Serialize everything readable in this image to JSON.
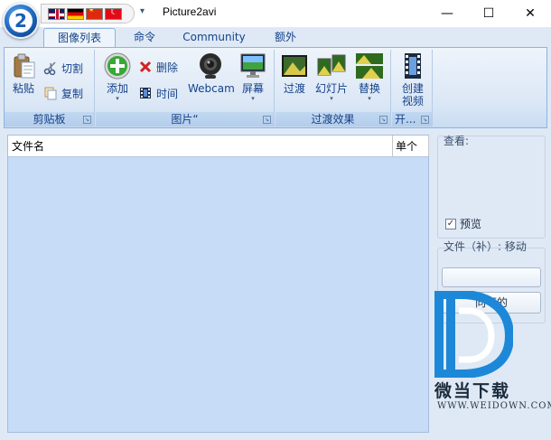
{
  "window": {
    "title": "Picture2avi",
    "app_orb_glyph": "2",
    "controls": {
      "minimize": "—",
      "maximize": "☐",
      "close": "✕"
    },
    "qat_dropdown": "▾"
  },
  "language_flags": [
    "uk-flag-icon",
    "de-flag-icon",
    "cn-flag-icon",
    "tr-flag-icon"
  ],
  "tabs": [
    {
      "label": "图像列表",
      "active": true
    },
    {
      "label": "命令",
      "active": false
    },
    {
      "label": "Community",
      "active": false
    },
    {
      "label": "额外",
      "active": false
    }
  ],
  "ribbon": {
    "clipboard": {
      "label": "剪贴板",
      "paste": "粘贴",
      "cut": "切割",
      "copy": "复制"
    },
    "images": {
      "label": "图片“",
      "add": "添加",
      "delete": "删除",
      "time": "时间",
      "webcam": "Webcam",
      "screen": "屏幕"
    },
    "transitions": {
      "label": "过渡效果",
      "transition": "过渡",
      "slideshow": "幻灯片",
      "replace": "替换"
    },
    "open": {
      "label": "开...",
      "create_video_line1": "创建",
      "create_video_line2": "视频"
    },
    "launcher_glyph": "↘",
    "caret_glyph": "▾"
  },
  "list": {
    "columns": [
      "文件名",
      "单个"
    ],
    "rows": []
  },
  "side_panel": {
    "view_label": "查看:",
    "preview_label": "预览",
    "preview_checked": true,
    "check_glyph": "✓",
    "file_label": "文件（补）: 移动",
    "field1_value": "",
    "button_label": "向下的"
  },
  "watermark": {
    "text": "微当下载",
    "url": "WWW.WEIDOWN.COM"
  },
  "colors": {
    "list_background": "#c6dcf7",
    "ribbon_border": "#8db2e3",
    "accent": "#15428b"
  }
}
